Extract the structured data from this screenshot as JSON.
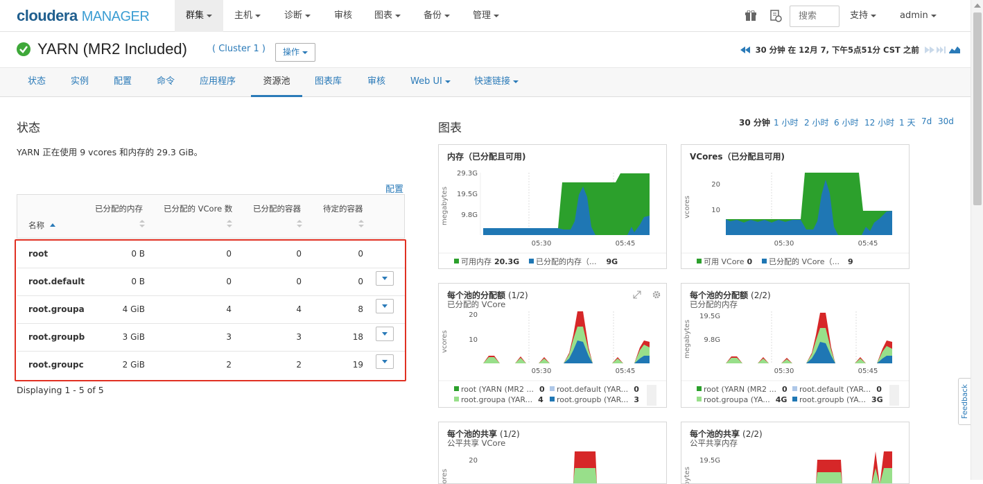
{
  "brand": {
    "name": "cloudera",
    "product": "MANAGER"
  },
  "topnav": {
    "items": [
      {
        "label": "群集"
      },
      {
        "label": "主机"
      },
      {
        "label": "诊断"
      },
      {
        "label": "审核"
      },
      {
        "label": "图表"
      },
      {
        "label": "备份"
      },
      {
        "label": "管理"
      }
    ],
    "search_placeholder": "搜索",
    "support": "支持",
    "user": "admin"
  },
  "service": {
    "title": "YARN (MR2 Included)",
    "cluster": "( Cluster 1 )",
    "actions": "操作",
    "time_context": "30 分钟 在 12月 7, 下午5点51分 CST 之前"
  },
  "tabs": [
    {
      "label": "状态"
    },
    {
      "label": "实例"
    },
    {
      "label": "配置"
    },
    {
      "label": "命令"
    },
    {
      "label": "应用程序"
    },
    {
      "label": "资源池"
    },
    {
      "label": "图表库"
    },
    {
      "label": "审核"
    },
    {
      "label": "Web UI"
    },
    {
      "label": "快速链接"
    }
  ],
  "status": {
    "heading": "状态",
    "text": "YARN 正在使用 9 vcores 和内存的 29.3 GiB。",
    "config_link": "配置",
    "columns": [
      "名称",
      "已分配的内存",
      "已分配的 VCore 数",
      "已分配的容器",
      "待定的容器"
    ],
    "rows": [
      {
        "name": "root",
        "memory": "0 B",
        "vcores": "0",
        "containers": "0",
        "pending": "0"
      },
      {
        "name": "root.default",
        "memory": "0 B",
        "vcores": "0",
        "containers": "0",
        "pending": "0"
      },
      {
        "name": "root.groupa",
        "memory": "4 GiB",
        "vcores": "4",
        "containers": "4",
        "pending": "8"
      },
      {
        "name": "root.groupb",
        "memory": "3 GiB",
        "vcores": "3",
        "containers": "3",
        "pending": "18"
      },
      {
        "name": "root.groupc",
        "memory": "2 GiB",
        "vcores": "2",
        "containers": "2",
        "pending": "19"
      }
    ],
    "footer": "Displaying 1 - 5 of 5"
  },
  "charts": {
    "heading": "图表",
    "ranges": [
      "30 分钟",
      "1 小时",
      "2 小时",
      "6 小时",
      "12 小时",
      "1 天",
      "7d",
      "30d"
    ],
    "selected_range": "30 分钟",
    "panels": [
      {
        "title": "内存（已分配且可用)",
        "ylabel": "megabytes",
        "yticks": [
          "29.3G",
          "19.5G",
          "9.8G"
        ],
        "xticks": [
          "05:30",
          "05:45"
        ],
        "legend": [
          {
            "label": "可用内存",
            "value": "20.3G",
            "color": "#2ca02c"
          },
          {
            "label": "已分配的内存（...",
            "value": "9G",
            "color": "#1f77b4"
          }
        ]
      },
      {
        "title": "VCores（已分配且可用)",
        "ylabel": "vcores",
        "yticks": [
          "20",
          "10"
        ],
        "xticks": [
          "05:30",
          "05:45"
        ],
        "legend": [
          {
            "label": "可用 VCore",
            "value": "0",
            "color": "#2ca02c"
          },
          {
            "label": "已分配的 VCore（...",
            "value": "9",
            "color": "#1f77b4"
          }
        ]
      },
      {
        "title": "每个池的分配额",
        "page": "(1/2)",
        "subtitle": "已分配的 VCore",
        "ylabel": "vcores",
        "yticks": [
          "20",
          "10"
        ],
        "xticks": [
          "05:30",
          "05:45"
        ],
        "legend": [
          {
            "label": "root (YARN (MR2 ...",
            "value": "0",
            "color": "#2ca02c"
          },
          {
            "label": "root.default (YAR...",
            "value": "0",
            "color": "#aec7e8"
          },
          {
            "label": "root.groupa (YAR...",
            "value": "4",
            "color": "#98df8a"
          },
          {
            "label": "root.groupb (YAR...",
            "value": "3",
            "color": "#1f77b4"
          }
        ]
      },
      {
        "title": "每个池的分配额",
        "page": "(2/2)",
        "subtitle": "已分配的内存",
        "ylabel": "megabytes",
        "yticks": [
          "19.5G",
          "9.8G"
        ],
        "xticks": [
          "05:30",
          "05:45"
        ],
        "legend": [
          {
            "label": "root (YARN (MR2 ...",
            "value": "0",
            "color": "#2ca02c"
          },
          {
            "label": "root.default (YAR...",
            "value": "0",
            "color": "#aec7e8"
          },
          {
            "label": "root.groupa (YA...",
            "value": "4G",
            "color": "#98df8a"
          },
          {
            "label": "root.groupb (YA...",
            "value": "3G",
            "color": "#1f77b4"
          }
        ]
      },
      {
        "title": "每个池的共享",
        "page": "(1/2)",
        "subtitle": "公平共享 VCore",
        "ylabel": "vcores",
        "yticks": [
          "20"
        ]
      },
      {
        "title": "每个池的共享",
        "page": "(2/2)",
        "subtitle": "公平共享内存",
        "ylabel": "megabytes",
        "yticks": [
          "19.5G"
        ]
      }
    ]
  },
  "feedback": "Feedback"
}
